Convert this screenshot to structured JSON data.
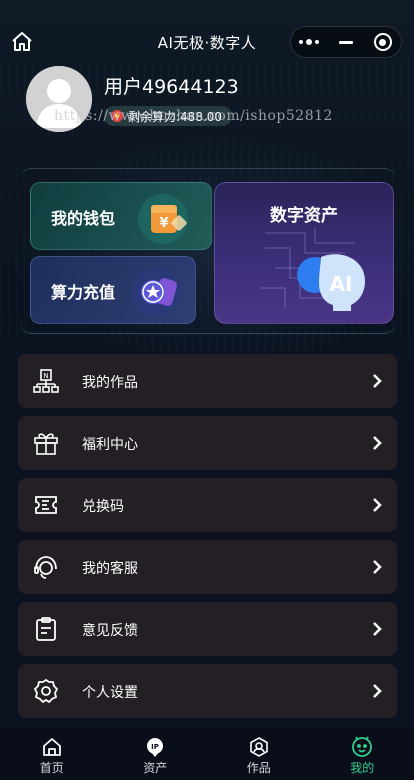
{
  "header": {
    "title": "AI无极·数字人"
  },
  "profile": {
    "username": "用户49644123",
    "balance_text": "剩余算力:488.00",
    "watermark": "https://www.huzhan.com/ishop52812"
  },
  "cards": {
    "wallet_label": "我的钱包",
    "recharge_label": "算力充值",
    "asset_label": "数字资产",
    "wallet_glyph": "¥",
    "asset_glyph": "AI"
  },
  "menu": [
    {
      "label": "我的作品",
      "icon": "works-icon"
    },
    {
      "label": "福利中心",
      "icon": "gift-icon"
    },
    {
      "label": "兑换码",
      "icon": "ticket-icon"
    },
    {
      "label": "我的客服",
      "icon": "support-icon"
    },
    {
      "label": "意见反馈",
      "icon": "feedback-icon"
    },
    {
      "label": "个人设置",
      "icon": "settings-icon"
    }
  ],
  "tabbar": [
    {
      "label": "首页",
      "icon": "home-icon"
    },
    {
      "label": "资产",
      "icon": "asset-icon"
    },
    {
      "label": "作品",
      "icon": "works-icon"
    },
    {
      "label": "我的",
      "icon": "profile-icon",
      "active": true
    }
  ],
  "colors": {
    "background": "#0c1220",
    "menu_bg": "#231f24",
    "accent_active": "#2fcf8f"
  }
}
